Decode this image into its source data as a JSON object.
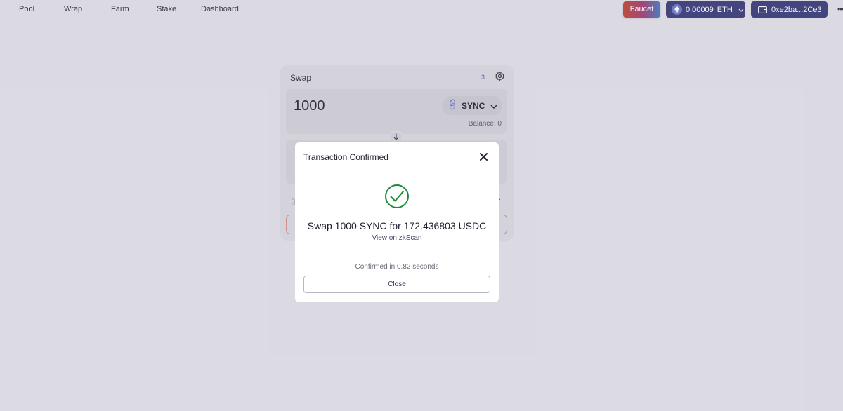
{
  "nav": {
    "links": [
      "Pool",
      "Wrap",
      "Farm",
      "Stake",
      "Dashboard"
    ],
    "faucet_label": "Faucet",
    "eth_balance": "0.00009",
    "eth_symbol": "ETH",
    "wallet_address": "0xe2ba...2Ce3"
  },
  "swap": {
    "title": "Swap",
    "badge": "3",
    "input_amount": "1000",
    "input_token": "SYNC",
    "balance_label": "Balance: 0"
  },
  "modal": {
    "title": "Transaction Confirmed",
    "message": "Swap 1000 SYNC for 172.436803 USDC",
    "link": "View on zkScan",
    "time": "Confirmed in 0.82 seconds",
    "close_label": "Close"
  },
  "colors": {
    "primary_button": "#383878",
    "success": "#1e8a3a",
    "background": "#e4e3ea"
  }
}
